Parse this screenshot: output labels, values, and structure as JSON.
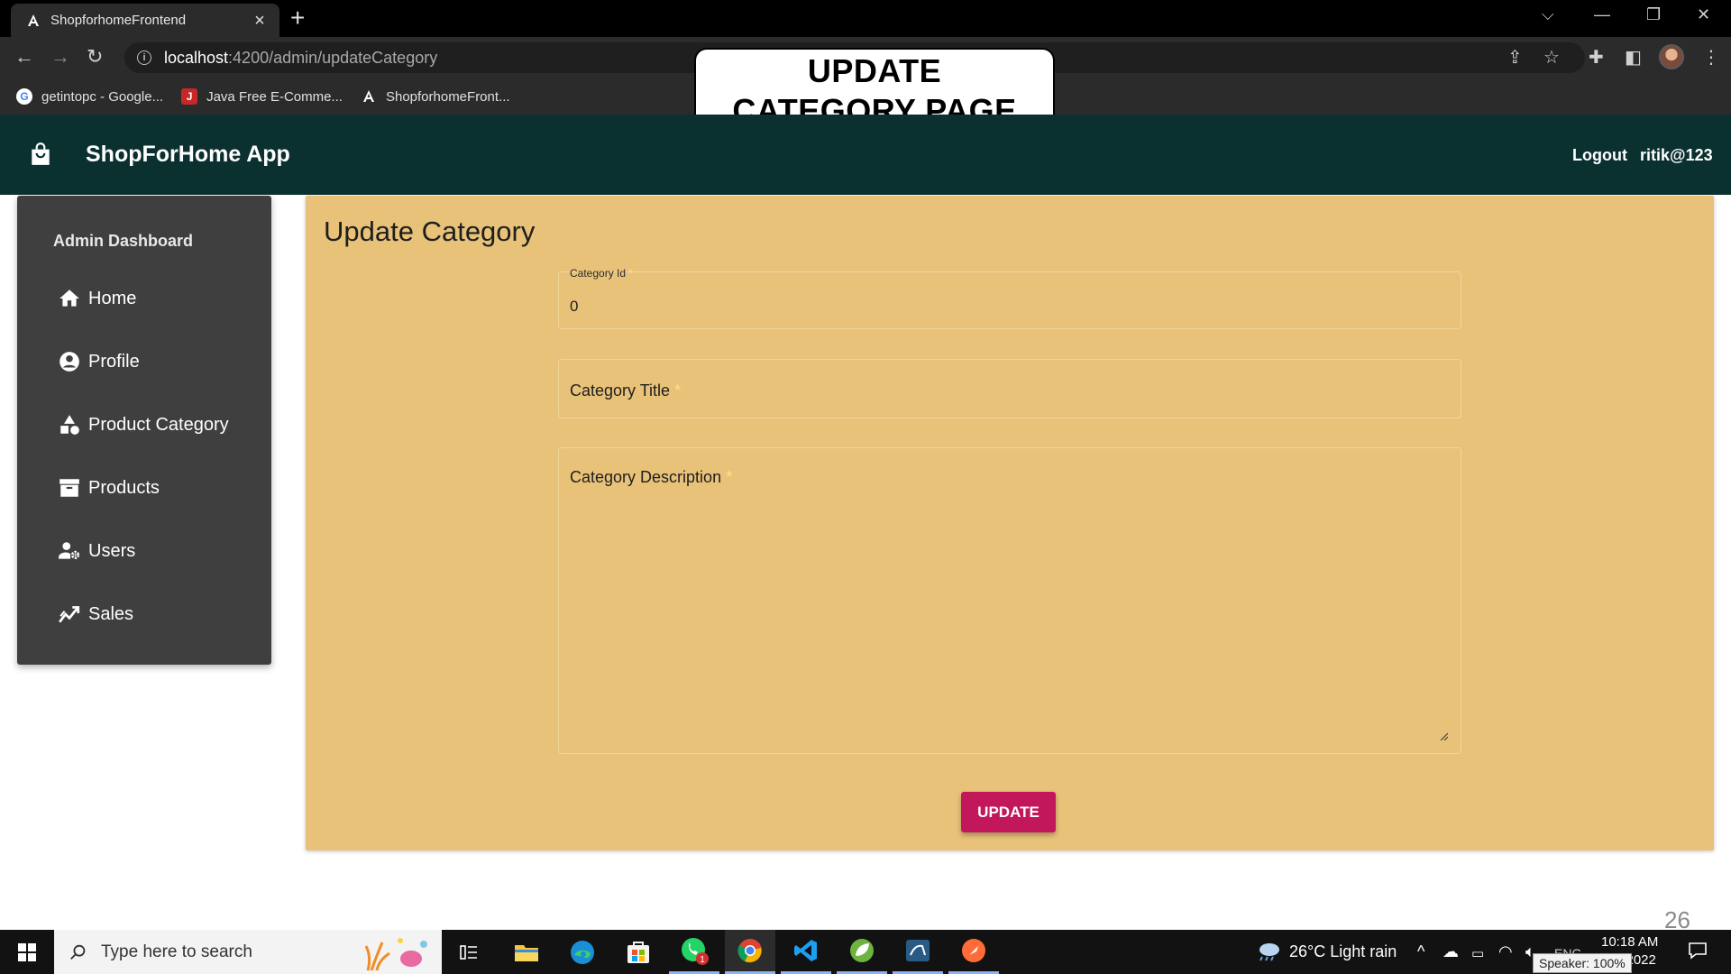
{
  "browser": {
    "tab_title": "ShopforhomeFrontend",
    "url_host": "localhost",
    "url_path": ":4200/admin/updateCategory",
    "bookmarks": [
      {
        "label": "getintopc - Google..."
      },
      {
        "label": "Java Free E-Comme..."
      },
      {
        "label": "ShopforhomeFront..."
      }
    ]
  },
  "overlay": {
    "line1": "UPDATE",
    "line2": "CATEGORY PAGE"
  },
  "header": {
    "brand": "ShopForHome App",
    "logout": "Logout",
    "user": "ritik@123"
  },
  "sidebar": {
    "title": "Admin Dashboard",
    "items": [
      {
        "label": "Home",
        "icon": "home-icon"
      },
      {
        "label": "Profile",
        "icon": "account-circle-icon"
      },
      {
        "label": "Product Category",
        "icon": "category-icon"
      },
      {
        "label": "Products",
        "icon": "inventory-icon"
      },
      {
        "label": "Users",
        "icon": "manage-accounts-icon"
      },
      {
        "label": "Sales",
        "icon": "trending-up-icon"
      }
    ]
  },
  "form": {
    "title": "Update Category",
    "category_id_label": "Category Id",
    "category_id_value": "0",
    "category_title_label": "Category Title",
    "category_description_label": "Category Description",
    "required_mark": "*",
    "update_button": "UPDATE"
  },
  "page_number": "26",
  "taskbar": {
    "search_placeholder": "Type here to search",
    "weather": "26°C  Light rain",
    "time": "10:18 AM",
    "date": "-2022",
    "lang": "ENG",
    "tooltip": "Speaker: 100%",
    "whatsapp_badge": "1"
  },
  "colors": {
    "header_bg": "#0b3030",
    "sidebar_bg": "#3f3f3f",
    "card_bg": "#e9c27a",
    "button_bg": "#c2185b"
  }
}
